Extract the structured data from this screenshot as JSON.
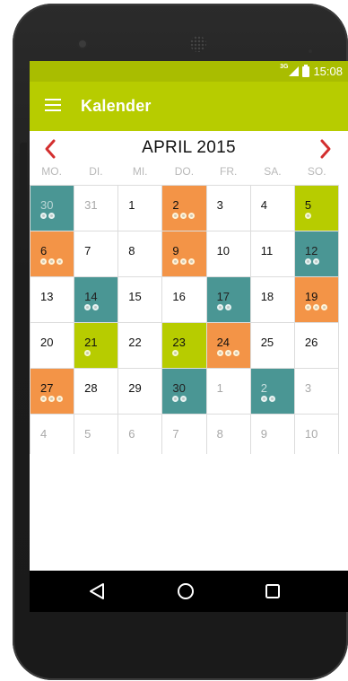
{
  "status_bar": {
    "network_label": "3G",
    "time": "15:08",
    "colors": {
      "bg": "#a9bd00"
    }
  },
  "app_bar": {
    "title": "Kalender",
    "menu_icon": "hamburger-menu-icon",
    "colors": {
      "bg": "#b7cc00"
    }
  },
  "calendar": {
    "month_title": "APRIL 2015",
    "prev_icon": "chevron-left-icon",
    "next_icon": "chevron-right-icon",
    "chevron_color": "#d32f2f",
    "weekdays": [
      "MO.",
      "DI.",
      "MI.",
      "DO.",
      "FR.",
      "SA.",
      "SO."
    ],
    "legend_colors": {
      "orange": "#f39447",
      "teal": "#4a9694",
      "green": "#b7cc00"
    },
    "days": [
      {
        "label": "30",
        "other_month": true,
        "color": "teal",
        "dots": 2
      },
      {
        "label": "31",
        "other_month": true,
        "color": "",
        "dots": 0
      },
      {
        "label": "1",
        "other_month": false,
        "color": "",
        "dots": 0
      },
      {
        "label": "2",
        "other_month": false,
        "color": "orange",
        "dots": 3
      },
      {
        "label": "3",
        "other_month": false,
        "color": "",
        "dots": 0
      },
      {
        "label": "4",
        "other_month": false,
        "color": "",
        "dots": 0
      },
      {
        "label": "5",
        "other_month": false,
        "color": "green",
        "dots": 1
      },
      {
        "label": "6",
        "other_month": false,
        "color": "orange",
        "dots": 3
      },
      {
        "label": "7",
        "other_month": false,
        "color": "",
        "dots": 0
      },
      {
        "label": "8",
        "other_month": false,
        "color": "",
        "dots": 0
      },
      {
        "label": "9",
        "other_month": false,
        "color": "orange",
        "dots": 3
      },
      {
        "label": "10",
        "other_month": false,
        "color": "",
        "dots": 0
      },
      {
        "label": "11",
        "other_month": false,
        "color": "",
        "dots": 0
      },
      {
        "label": "12",
        "other_month": false,
        "color": "teal",
        "dots": 2
      },
      {
        "label": "13",
        "other_month": false,
        "color": "",
        "dots": 0
      },
      {
        "label": "14",
        "other_month": false,
        "color": "teal",
        "dots": 2
      },
      {
        "label": "15",
        "other_month": false,
        "color": "",
        "dots": 0
      },
      {
        "label": "16",
        "other_month": false,
        "color": "",
        "dots": 0
      },
      {
        "label": "17",
        "other_month": false,
        "color": "teal",
        "dots": 2
      },
      {
        "label": "18",
        "other_month": false,
        "color": "",
        "dots": 0
      },
      {
        "label": "19",
        "other_month": false,
        "color": "orange",
        "dots": 3
      },
      {
        "label": "20",
        "other_month": false,
        "color": "",
        "dots": 0
      },
      {
        "label": "21",
        "other_month": false,
        "color": "green",
        "dots": 1
      },
      {
        "label": "22",
        "other_month": false,
        "color": "",
        "dots": 0
      },
      {
        "label": "23",
        "other_month": false,
        "color": "green",
        "dots": 1
      },
      {
        "label": "24",
        "other_month": false,
        "color": "orange",
        "dots": 3
      },
      {
        "label": "25",
        "other_month": false,
        "color": "",
        "dots": 0
      },
      {
        "label": "26",
        "other_month": false,
        "color": "",
        "dots": 0
      },
      {
        "label": "27",
        "other_month": false,
        "color": "orange",
        "dots": 3
      },
      {
        "label": "28",
        "other_month": false,
        "color": "",
        "dots": 0
      },
      {
        "label": "29",
        "other_month": false,
        "color": "",
        "dots": 0
      },
      {
        "label": "30",
        "other_month": false,
        "color": "teal",
        "dots": 2
      },
      {
        "label": "1",
        "other_month": true,
        "color": "",
        "dots": 0
      },
      {
        "label": "2",
        "other_month": true,
        "color": "teal",
        "dots": 2
      },
      {
        "label": "3",
        "other_month": true,
        "color": "",
        "dots": 0
      },
      {
        "label": "4",
        "other_month": true,
        "color": "",
        "dots": 0
      },
      {
        "label": "5",
        "other_month": true,
        "color": "",
        "dots": 0
      },
      {
        "label": "6",
        "other_month": true,
        "color": "",
        "dots": 0
      },
      {
        "label": "7",
        "other_month": true,
        "color": "",
        "dots": 0
      },
      {
        "label": "8",
        "other_month": true,
        "color": "",
        "dots": 0
      },
      {
        "label": "9",
        "other_month": true,
        "color": "",
        "dots": 0
      },
      {
        "label": "10",
        "other_month": true,
        "color": "",
        "dots": 0
      }
    ]
  },
  "nav_bar": {
    "icons": [
      "back-triangle-icon",
      "home-circle-icon",
      "recent-apps-square-icon"
    ]
  }
}
